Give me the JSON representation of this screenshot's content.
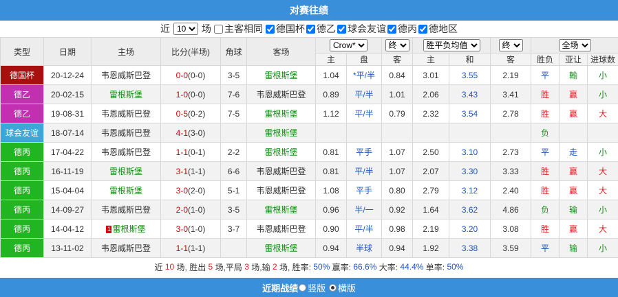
{
  "title": "对赛往绩",
  "filter": {
    "prefix": "近",
    "count": "10",
    "suffix": "场",
    "same_home": {
      "label": "主客相同",
      "checked": false
    },
    "leagues": [
      {
        "label": "德国杯",
        "checked": true
      },
      {
        "label": "德乙",
        "checked": true
      },
      {
        "label": "球会友谊",
        "checked": true
      },
      {
        "label": "德丙",
        "checked": true
      },
      {
        "label": "德地区",
        "checked": true
      }
    ]
  },
  "headers": {
    "type": "类型",
    "date": "日期",
    "home": "主场",
    "score": "比分(半场)",
    "corner": "角球",
    "away": "客场",
    "company": "Crow*",
    "handicap_stage": "终",
    "odds_select": "胜平负均值",
    "odds_stage": "终",
    "scope": "全场",
    "sub": {
      "h_home": "主",
      "h_line": "盘",
      "h_away": "客",
      "o_home": "主",
      "o_draw": "和",
      "o_away": "客",
      "result": "胜负",
      "asia": "亚让",
      "goals": "进球数"
    }
  },
  "colors": {
    "德国杯": "#a80f0f",
    "德乙": "#c22fb0",
    "球会友谊": "#3aa7d8",
    "德丙": "#22b522"
  },
  "rows": [
    {
      "league": "德国杯",
      "date": "20-12-24",
      "home": "韦恩威斯巴登",
      "home_green": false,
      "red_card": "",
      "score": "0-0",
      "half": "(0-0)",
      "corner": "3-5",
      "away": "雷根斯堡",
      "away_green": true,
      "hh": "1.04",
      "hl": "*平/半",
      "ha": "0.84",
      "oh": "3.01",
      "od": "3.55",
      "oa": "2.19",
      "res": "平",
      "asia": "輸",
      "goals": "小"
    },
    {
      "league": "德乙",
      "date": "20-02-15",
      "home": "雷根斯堡",
      "home_green": true,
      "red_card": "",
      "score": "1-0",
      "half": "(0-0)",
      "corner": "7-6",
      "away": "韦恩威斯巴登",
      "away_green": false,
      "hh": "0.89",
      "hl": "平/半",
      "ha": "1.01",
      "oh": "2.06",
      "od": "3.43",
      "oa": "3.41",
      "res": "胜",
      "asia": "赢",
      "goals": "小"
    },
    {
      "league": "德乙",
      "date": "19-08-31",
      "home": "韦恩威斯巴登",
      "home_green": false,
      "red_card": "",
      "score": "0-5",
      "half": "(0-2)",
      "corner": "7-5",
      "away": "雷根斯堡",
      "away_green": true,
      "hh": "1.12",
      "hl": "平/半",
      "ha": "0.79",
      "oh": "2.32",
      "od": "3.54",
      "oa": "2.78",
      "res": "胜",
      "asia": "赢",
      "goals": "大"
    },
    {
      "league": "球会友谊",
      "date": "18-07-14",
      "home": "韦恩威斯巴登",
      "home_green": false,
      "red_card": "",
      "score": "4-1",
      "half": "(3-0)",
      "corner": "",
      "away": "雷根斯堡",
      "away_green": true,
      "hh": "",
      "hl": "",
      "ha": "",
      "oh": "",
      "od": "",
      "oa": "",
      "res": "负",
      "asia": "",
      "goals": ""
    },
    {
      "league": "德丙",
      "date": "17-04-22",
      "home": "韦恩威斯巴登",
      "home_green": false,
      "red_card": "",
      "score": "1-1",
      "half": "(0-1)",
      "corner": "2-2",
      "away": "雷根斯堡",
      "away_green": true,
      "hh": "0.81",
      "hl": "平手",
      "ha": "1.07",
      "oh": "2.50",
      "od": "3.10",
      "oa": "2.73",
      "res": "平",
      "asia": "走",
      "goals": "小"
    },
    {
      "league": "德丙",
      "date": "16-11-19",
      "home": "雷根斯堡",
      "home_green": true,
      "red_card": "",
      "score": "3-1",
      "half": "(1-1)",
      "corner": "6-6",
      "away": "韦恩威斯巴登",
      "away_green": false,
      "hh": "0.81",
      "hl": "平/半",
      "ha": "1.07",
      "oh": "2.07",
      "od": "3.30",
      "oa": "3.33",
      "res": "胜",
      "asia": "赢",
      "goals": "大"
    },
    {
      "league": "德丙",
      "date": "15-04-04",
      "home": "雷根斯堡",
      "home_green": true,
      "red_card": "",
      "score": "3-0",
      "half": "(2-0)",
      "corner": "5-1",
      "away": "韦恩威斯巴登",
      "away_green": false,
      "hh": "1.08",
      "hl": "平手",
      "ha": "0.80",
      "oh": "2.79",
      "od": "3.12",
      "oa": "2.40",
      "res": "胜",
      "asia": "赢",
      "goals": "大"
    },
    {
      "league": "德丙",
      "date": "14-09-27",
      "home": "韦恩威斯巴登",
      "home_green": false,
      "red_card": "",
      "score": "2-0",
      "half": "(1-0)",
      "corner": "3-5",
      "away": "雷根斯堡",
      "away_green": true,
      "hh": "0.96",
      "hl": "半/一",
      "ha": "0.92",
      "oh": "1.64",
      "od": "3.62",
      "oa": "4.86",
      "res": "负",
      "asia": "输",
      "goals": "小"
    },
    {
      "league": "德丙",
      "date": "14-04-12",
      "home": "雷根斯堡",
      "home_green": true,
      "red_card": "1",
      "score": "3-0",
      "half": "(1-0)",
      "corner": "3-7",
      "away": "韦恩威斯巴登",
      "away_green": false,
      "hh": "0.90",
      "hl": "平/半",
      "ha": "0.98",
      "oh": "2.19",
      "od": "3.20",
      "oa": "3.08",
      "res": "胜",
      "asia": "赢",
      "goals": "大"
    },
    {
      "league": "德丙",
      "date": "13-11-02",
      "home": "韦恩威斯巴登",
      "home_green": false,
      "red_card": "",
      "score": "1-1",
      "half": "(1-1)",
      "corner": "",
      "away": "雷根斯堡",
      "away_green": true,
      "hh": "0.94",
      "hl": "半球",
      "ha": "0.94",
      "oh": "1.92",
      "od": "3.38",
      "oa": "3.59",
      "res": "平",
      "asia": "输",
      "goals": "小"
    }
  ],
  "summary": {
    "t1": "近 ",
    "games": "10",
    "t2": " 场, 胜出 ",
    "wins": "5",
    "t3": " 场,平局 ",
    "draws": "3",
    "t4": " 场,输 ",
    "losses": "2",
    "t5": " 场, 胜率: ",
    "win_rate": "50%",
    "t6": " 赢率: ",
    "asia_rate": "66.6%",
    "t7": " 大率: ",
    "big_rate": "44.4%",
    "t8": " 单率: ",
    "odd_rate": "50%"
  },
  "footer": {
    "title": "近期战绩",
    "opt1": "竖版",
    "opt2": "横版",
    "selected": "横版"
  }
}
